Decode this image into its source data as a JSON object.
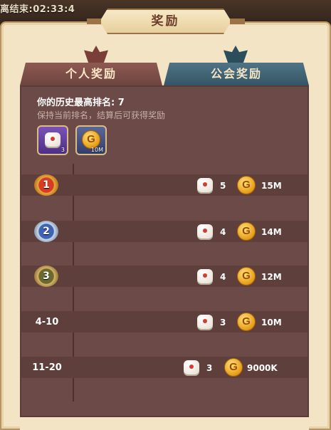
{
  "timer": {
    "text": "离结束:02:33:4"
  },
  "header": {
    "title": "奖励"
  },
  "tabs": [
    {
      "label": "个人奖励",
      "active": true
    },
    {
      "label": "公会奖励",
      "active": false
    }
  ],
  "best_rank": {
    "text": "你的历史最高排名: 7"
  },
  "hint": {
    "text": "保持当前排名，结算后可获得奖励"
  },
  "current_rewards": [
    {
      "icon": "dice-icon",
      "count": "3"
    },
    {
      "icon": "gold-coin-icon",
      "count": "10M"
    }
  ],
  "rank_rewards": [
    {
      "rank": "1",
      "dice": "5",
      "gold": "15M",
      "medal": "gold"
    },
    {
      "rank": "2",
      "dice": "4",
      "gold": "14M",
      "medal": "silver"
    },
    {
      "rank": "3",
      "dice": "4",
      "gold": "12M",
      "medal": "bronze"
    },
    {
      "rank": "4-10",
      "dice": "3",
      "gold": "10M"
    },
    {
      "rank": "11-20",
      "dice": "3",
      "gold": "9000K"
    }
  ],
  "colors": {
    "panel_bg": "#f2e4c4",
    "content_bg": "#6b4a47",
    "active_tab": "#8d5a52",
    "inactive_tab": "#4f7485",
    "coin": "#e59c17"
  }
}
